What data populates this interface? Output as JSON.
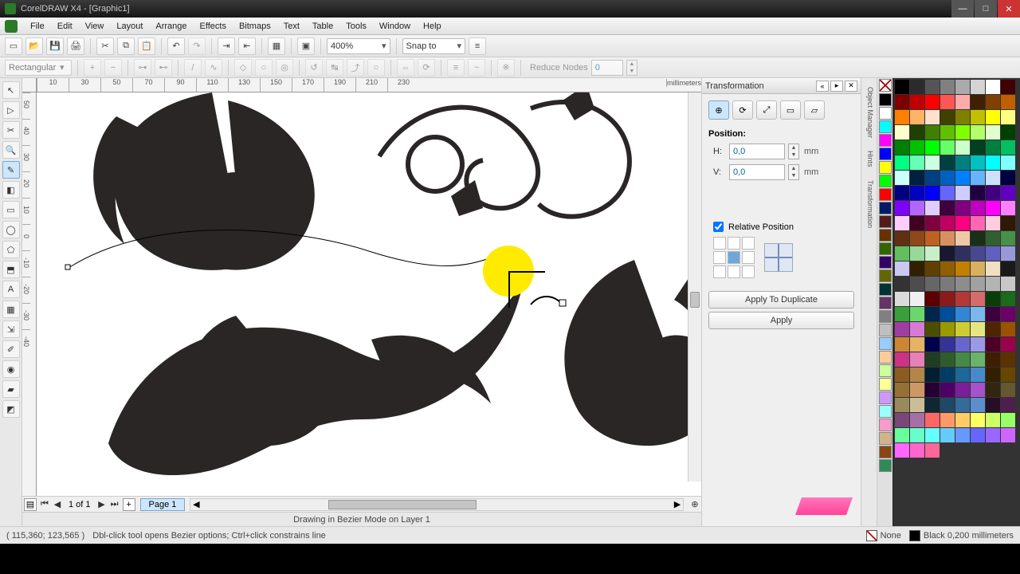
{
  "titlebar": {
    "text": "CorelDRAW X4 - [Graphic1]"
  },
  "menu": [
    "File",
    "Edit",
    "View",
    "Layout",
    "Arrange",
    "Effects",
    "Bitmaps",
    "Text",
    "Table",
    "Tools",
    "Window",
    "Help"
  ],
  "toolbar1": {
    "zoom": "400%",
    "snap_label": "Snap to"
  },
  "propbar": {
    "shape_mode": "Rectangular",
    "reduce_label": "Reduce Nodes",
    "reduce_value": "0"
  },
  "ruler": {
    "unit": "millimeters",
    "hticks": [
      "10",
      "30",
      "50",
      "70",
      "90",
      "110",
      "130",
      "150",
      "170",
      "190",
      "210",
      "230"
    ],
    "vticks": [
      "50",
      "40",
      "30",
      "20",
      "10",
      "0",
      "-10",
      "-20",
      "-30",
      "-40"
    ]
  },
  "docker": {
    "title": "Transformation",
    "tabs": [
      "position",
      "rotate",
      "scale",
      "size",
      "skew"
    ],
    "section": "Position:",
    "h_label": "H:",
    "h_value": "0,0",
    "v_label": "V:",
    "v_value": "0,0",
    "unit": "mm",
    "relative": "Relative Position",
    "apply_dup": "Apply To Duplicate",
    "apply": "Apply"
  },
  "right_tabs": [
    "Object Manager",
    "Hints",
    "Transformation"
  ],
  "pagebar": {
    "page_of": "1 of 1",
    "tab": "Page 1"
  },
  "infoline": "Drawing in Bezier Mode on Layer 1",
  "statusbar": {
    "coords": "( 115,360; 123,565 )",
    "hint": "Dbl-click tool opens Bezier options; Ctrl+click constrains line",
    "fill": "None",
    "outline": "Black  0,200 millimeters"
  },
  "colors_small": [
    "#000000",
    "#ffffff",
    "#00ffff",
    "#ff00ff",
    "#0000ff",
    "#ffff00",
    "#00ff00",
    "#ff0000",
    "#001a66",
    "#541b1b",
    "#663300",
    "#336600",
    "#330066",
    "#666600",
    "#003333",
    "#663366",
    "#808080",
    "#c0c0c0",
    "#99ccff",
    "#ffcc99",
    "#ccff99",
    "#ffff99",
    "#cc99ff",
    "#99ffff",
    "#ff99cc",
    "#d2b48c",
    "#8b4513",
    "#2e8b57"
  ],
  "colors_big": [
    "#000000",
    "#2b2b2b",
    "#555555",
    "#808080",
    "#aaaaaa",
    "#d4d4d4",
    "#ffffff",
    "#400000",
    "#800000",
    "#c00000",
    "#ff0000",
    "#ff5555",
    "#ffaaaa",
    "#402000",
    "#804000",
    "#c06000",
    "#ff8000",
    "#ffb366",
    "#ffe0cc",
    "#404000",
    "#808000",
    "#c0c000",
    "#ffff00",
    "#ffff80",
    "#ffffcc",
    "#204000",
    "#408000",
    "#60c000",
    "#80ff00",
    "#b3ff66",
    "#e0ffcc",
    "#004000",
    "#008000",
    "#00c000",
    "#00ff00",
    "#66ff66",
    "#ccffcc",
    "#004020",
    "#008040",
    "#00c060",
    "#00ff80",
    "#66ffb3",
    "#ccffe0",
    "#004040",
    "#008080",
    "#00c0c0",
    "#00ffff",
    "#80ffff",
    "#ccffff",
    "#002040",
    "#004080",
    "#0060c0",
    "#0080ff",
    "#66b3ff",
    "#cce0ff",
    "#000040",
    "#000080",
    "#0000c0",
    "#0000ff",
    "#6666ff",
    "#ccccff",
    "#200040",
    "#400080",
    "#6000c0",
    "#8000ff",
    "#b366ff",
    "#e0ccff",
    "#400040",
    "#800080",
    "#c000c0",
    "#ff00ff",
    "#ff80ff",
    "#ffccff",
    "#400020",
    "#800040",
    "#c00060",
    "#ff0080",
    "#ff66b3",
    "#ffcce0",
    "#301808",
    "#603010",
    "#904818",
    "#c06020",
    "#d89060",
    "#f0c8a8",
    "#183018",
    "#306030",
    "#489048",
    "#60c060",
    "#98d898",
    "#c8f0c8",
    "#181830",
    "#303060",
    "#484890",
    "#6060c0",
    "#9898d8",
    "#c8c8f0",
    "#302000",
    "#604000",
    "#906000",
    "#c08000",
    "#d8b060",
    "#f0e0c0",
    "#1a1a1a",
    "#333333",
    "#4d4d4d",
    "#666666",
    "#7a7a7a",
    "#8d8d8d",
    "#a1a1a1",
    "#b4b4b4",
    "#c8c8c8",
    "#dbdbdb",
    "#efefef",
    "#5c0000",
    "#8b1a1a",
    "#b33939",
    "#d66b6b",
    "#0b3d0b",
    "#1a6b1a",
    "#39a039",
    "#6bd66b",
    "#00264d",
    "#004d99",
    "#3385d6",
    "#7ab8eb",
    "#3d003d",
    "#6b006b",
    "#a03da0",
    "#d67ad6",
    "#4d4d00",
    "#999900",
    "#cccc33",
    "#e6e680",
    "#4d2600",
    "#995200",
    "#cc8533",
    "#e6b366",
    "#00004d",
    "#333399",
    "#6666cc",
    "#9999e6",
    "#4d0026",
    "#99004d",
    "#cc3385",
    "#e680b8",
    "#1f3d1f",
    "#2e5c2e",
    "#478a47",
    "#6bb36b",
    "#3d1f00",
    "#5c3300",
    "#8a5c1f",
    "#b38547",
    "#001f33",
    "#003d66",
    "#1f6699",
    "#478acc",
    "#331f00",
    "#664700",
    "#997033",
    "#cc9966",
    "#260033",
    "#4d0066",
    "#7a1f99",
    "#a652cc",
    "#33260f",
    "#665733",
    "#998a5c",
    "#ccbd99",
    "#0f2633",
    "#1f4766",
    "#336b99",
    "#5c8ecc",
    "#260f26",
    "#4d1f4d",
    "#7a477a",
    "#a670a6",
    "#ff6666",
    "#ff9966",
    "#ffcc66",
    "#ffff66",
    "#ccff66",
    "#99ff66",
    "#66ff99",
    "#66ffcc",
    "#66ffff",
    "#66ccff",
    "#6699ff",
    "#6666ff",
    "#9966ff",
    "#cc66ff",
    "#ff66ff",
    "#ff66cc",
    "#ff6699"
  ]
}
